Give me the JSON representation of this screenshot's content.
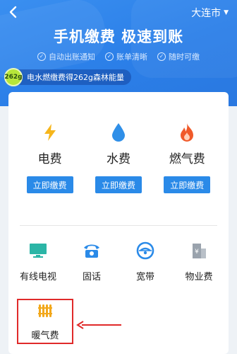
{
  "header": {
    "city": "大连市",
    "title": "手机缴费 极速到账",
    "features": [
      "自动出账通知",
      "账单清晰",
      "随时可缴"
    ],
    "promo_badge": "262g",
    "promo_text": "电水燃缴费得262g森林能量"
  },
  "utilities": [
    {
      "label": "电费",
      "button": "立即缴费",
      "icon": "lightning-icon",
      "color": "#f6b61c"
    },
    {
      "label": "水费",
      "button": "立即缴费",
      "icon": "water-drop-icon",
      "color": "#2f8fe8"
    },
    {
      "label": "燃气费",
      "button": "立即缴费",
      "icon": "flame-icon",
      "color": "#f05a2a"
    }
  ],
  "services": [
    {
      "label": "有线电视",
      "icon": "tv-icon",
      "color": "#2bb5a6"
    },
    {
      "label": "固话",
      "icon": "telephone-icon",
      "color": "#2a8ae8"
    },
    {
      "label": "宽带",
      "icon": "broadband-icon",
      "color": "#2a8ae8"
    },
    {
      "label": "物业费",
      "icon": "property-icon",
      "color": "#9aa3ad"
    }
  ],
  "heating": {
    "label": "暖气费",
    "icon": "radiator-icon",
    "color": "#f2a81c"
  },
  "accent": "#2a8ae8",
  "highlight_color": "#e02a2a"
}
